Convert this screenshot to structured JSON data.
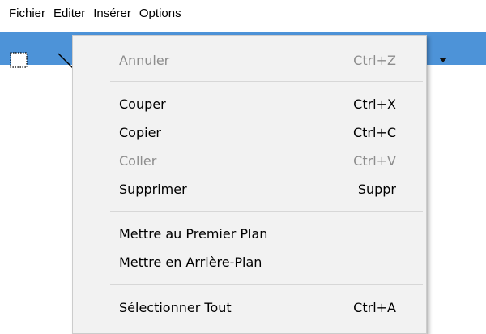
{
  "menubar": {
    "items": [
      {
        "label": "Fichier"
      },
      {
        "label": "Editer"
      },
      {
        "label": "Insérer"
      },
      {
        "label": "Options"
      }
    ]
  },
  "toolbar": {
    "background": "#4d93d8",
    "icons": [
      "selection-rectangle-icon",
      "line-tool-icon",
      "dropdown-arrow-icon"
    ]
  },
  "edit_menu": {
    "items": [
      {
        "label": "Annuler",
        "shortcut": "Ctrl+Z",
        "enabled": false
      },
      {
        "label": "Couper",
        "shortcut": "Ctrl+X",
        "enabled": true
      },
      {
        "label": "Copier",
        "shortcut": "Ctrl+C",
        "enabled": true
      },
      {
        "label": "Coller",
        "shortcut": "Ctrl+V",
        "enabled": false
      },
      {
        "label": "Supprimer",
        "shortcut": "Suppr",
        "enabled": true
      },
      {
        "label": "Mettre au Premier Plan",
        "shortcut": "",
        "enabled": true
      },
      {
        "label": "Mettre en Arrière-Plan",
        "shortcut": "",
        "enabled": true
      },
      {
        "label": "Sélectionner Tout",
        "shortcut": "Ctrl+A",
        "enabled": true
      }
    ]
  },
  "colors": {
    "menu_background": "#f2f2f2",
    "disabled_text": "#8d8d8d",
    "toolbar": "#4d93d8"
  }
}
